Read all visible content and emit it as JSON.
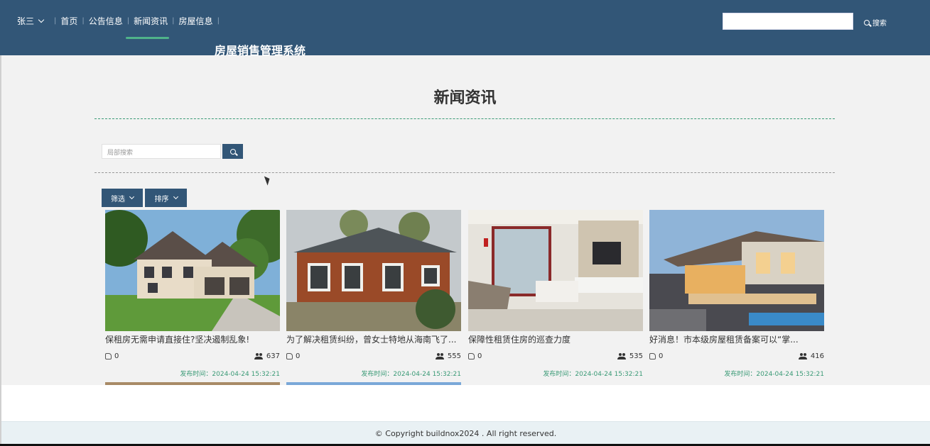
{
  "header": {
    "user": "张三",
    "nav": [
      "首页",
      "公告信息",
      "新闻资讯",
      "房屋信息"
    ],
    "brand": "房屋销售管理系统",
    "search_button": "搜索"
  },
  "main": {
    "title": "新闻资讯",
    "local_search_placeholder": "局部搜索",
    "filter_label": "筛选",
    "sort_label": "排序",
    "cards": [
      {
        "title": "保租房无需申请直接住?坚决遏制乱象!",
        "likes": "0",
        "views": "637",
        "time": "发布时间：2024-04-24 15:32:21"
      },
      {
        "title": "为了解决租赁纠纷，曾女士特地从海南飞了...",
        "likes": "0",
        "views": "555",
        "time": "发布时间：2024-04-24 15:32:21"
      },
      {
        "title": "保障性租赁住房的巡查力度",
        "likes": "0",
        "views": "535",
        "time": "发布时间：2024-04-24 15:32:21"
      },
      {
        "title": "好消息！市本级房屋租赁备案可以“掌...",
        "likes": "0",
        "views": "416",
        "time": "发布时间：2024-04-24 15:32:21"
      }
    ]
  },
  "footer": {
    "copyright": "© Copyright buildnox2024 . All right reserved."
  },
  "colors": {
    "header_bg": "#325677",
    "accent_green": "#3a9a76",
    "page_bg": "#f2f2f2"
  }
}
